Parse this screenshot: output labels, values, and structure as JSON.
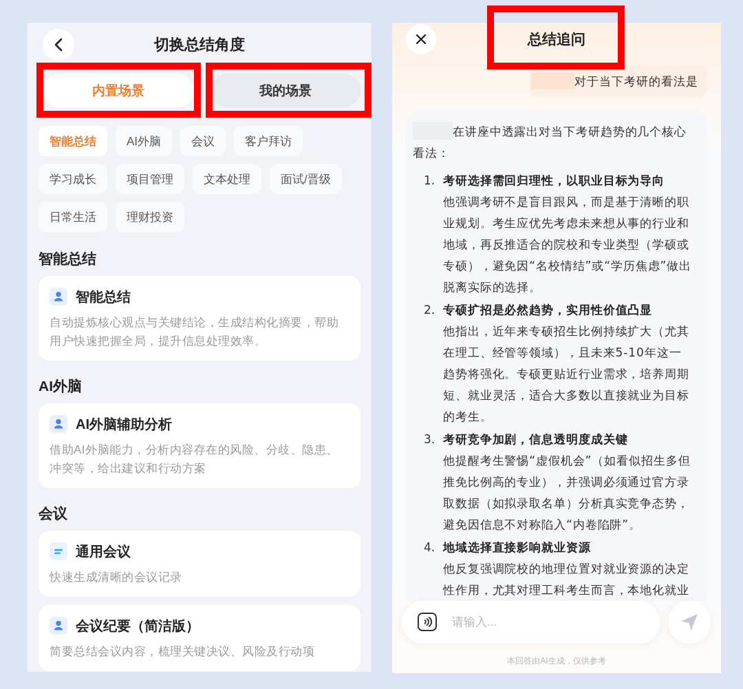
{
  "left_panel": {
    "title": "切换总结角度",
    "tabs": [
      {
        "label": "内置场景",
        "selected": true,
        "highlighted": true
      },
      {
        "label": "我的场景",
        "selected": false,
        "highlighted": true
      }
    ],
    "chips": [
      {
        "label": "智能总结",
        "selected": true
      },
      {
        "label": "AI外脑",
        "selected": false
      },
      {
        "label": "会议",
        "selected": false
      },
      {
        "label": "客户拜访",
        "selected": false
      },
      {
        "label": "学习成长",
        "selected": false
      },
      {
        "label": "项目管理",
        "selected": false
      },
      {
        "label": "文本处理",
        "selected": false
      },
      {
        "label": "面试/晋级",
        "selected": false
      },
      {
        "label": "日常生活",
        "selected": false
      },
      {
        "label": "理财投资",
        "selected": false
      }
    ],
    "sections": [
      {
        "heading": "智能总结",
        "cards": [
          {
            "kind": "persona",
            "title": "智能总结",
            "description": "自动提炼核心观点与关键结论，生成结构化摘要，帮助用户快速把握全局，提升信息处理效率。"
          }
        ]
      },
      {
        "heading": "AI外脑",
        "cards": [
          {
            "kind": "persona",
            "title": "AI外脑辅助分析",
            "description": "借助AI外脑能力，分析内容存在的风险、分歧、隐患、冲突等，给出建议和行动方案"
          }
        ]
      },
      {
        "heading": "会议",
        "cards": [
          {
            "kind": "notes",
            "title": "通用会议",
            "description": "快速生成清晰的会议记录"
          },
          {
            "kind": "persona",
            "title": "会议纪要（简洁版）",
            "description": "简要总结会议内容，梳理关键决议、风险及行动项"
          }
        ]
      }
    ]
  },
  "right_panel": {
    "title": {
      "text": "总结追问",
      "highlighted": true
    },
    "user_message": {
      "redacted_prefix": true,
      "text": "对于当下考研的看法是"
    },
    "answer": {
      "redacted_prefix": true,
      "intro": "在讲座中透露出对当下考研趋势的几个核心看法：",
      "points": [
        {
          "number": "1.",
          "title": "考研选择需回归理性，以职业目标为导向",
          "body": "他强调考研不是盲目跟风，而是基于清晰的职业规划。考生应优先考虑未来想从事的行业和地域，再反推适合的院校和专业类型（学硕或专硕），避免因“名校情结”或“学历焦虑”做出脱离实际的选择。"
        },
        {
          "number": "2.",
          "title": "专硕扩招是必然趋势，实用性价值凸显",
          "body": "他指出，近年来专硕招生比例持续扩大（尤其在理工、经管等领域），且未来5-10年这一趋势将强化。专硕更贴近行业需求，培养周期短、就业灵活，适合大多数以直接就业为目标的考生。"
        },
        {
          "number": "3.",
          "title": "考研竞争加剧，信息透明度成关键",
          "body": "他提醒考生警惕“虚假机会”（如看似招生多但推免比例高的专业），并强调必须通过官方录取数据（如拟录取名单）分析真实竞争态势，避免因信息不对称陷入“内卷陷阱”。"
        },
        {
          "number": "4.",
          "title": "地域选择直接影响就业资源",
          "body": "他反复强调院校的地理位置对就业资源的决定性作用，尤其对理工科考生而言，本地化就业"
        }
      ]
    },
    "input": {
      "placeholder": "请输入..."
    },
    "disclaimer": "本回答由AI生成，仅供参考"
  }
}
